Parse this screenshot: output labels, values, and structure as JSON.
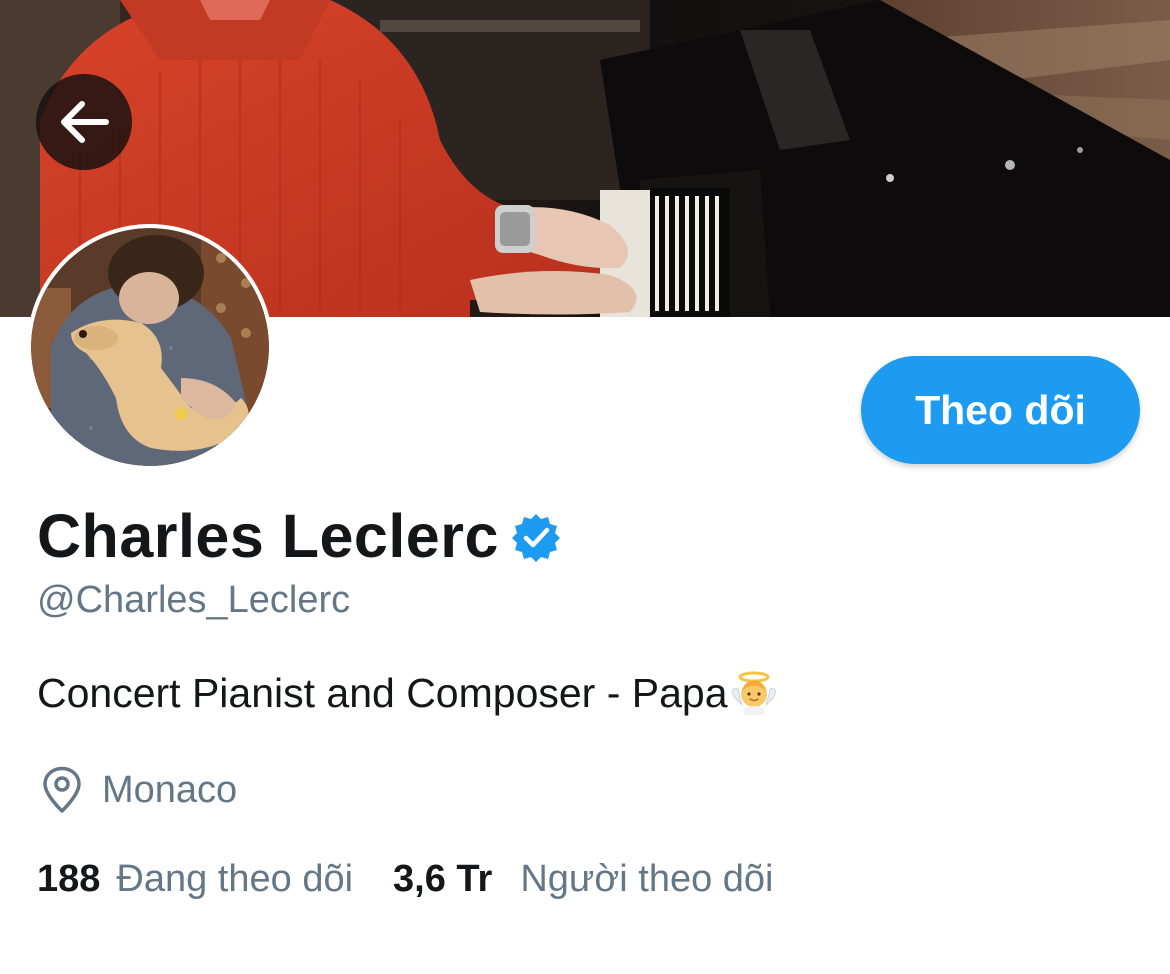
{
  "profile": {
    "display_name": "Charles Leclerc",
    "handle": "@Charles_Leclerc",
    "bio": "Concert Pianist and Composer - Papa",
    "bio_emoji": "baby-angel-emoji",
    "location": "Monaco",
    "verified": true
  },
  "actions": {
    "follow_label": "Theo dõi"
  },
  "stats": {
    "following_count": "188",
    "following_label": "Đang theo dõi",
    "followers_count": "3,6 Tr",
    "followers_label": "Người theo dõi"
  },
  "icons": {
    "back": "arrow-left-icon",
    "verified": "verified-badge-icon",
    "location": "location-pin-icon"
  },
  "colors": {
    "accent": "#1d9bf0",
    "text_primary": "#14171a",
    "text_secondary": "#657786"
  }
}
